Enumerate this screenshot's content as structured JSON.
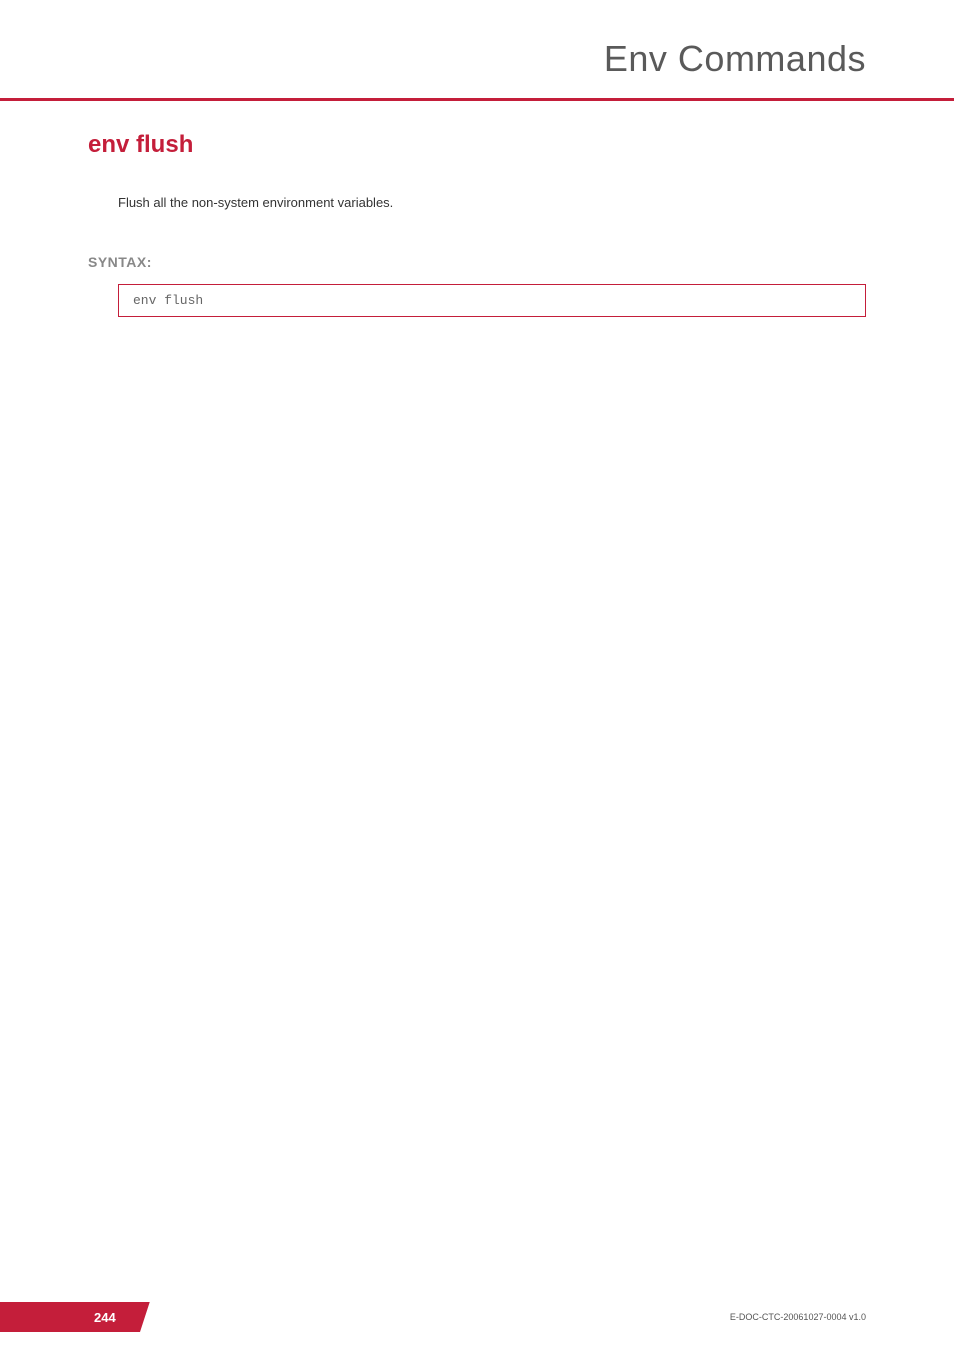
{
  "header": {
    "title": "Env Commands"
  },
  "command": {
    "name": "env flush",
    "description": "Flush all the non-system environment variables.",
    "syntax_label": "SYNTAX:",
    "syntax_code": "env flush"
  },
  "footer": {
    "page_number": "244",
    "doc_id": "E-DOC-CTC-20061027-0004 v1.0"
  }
}
